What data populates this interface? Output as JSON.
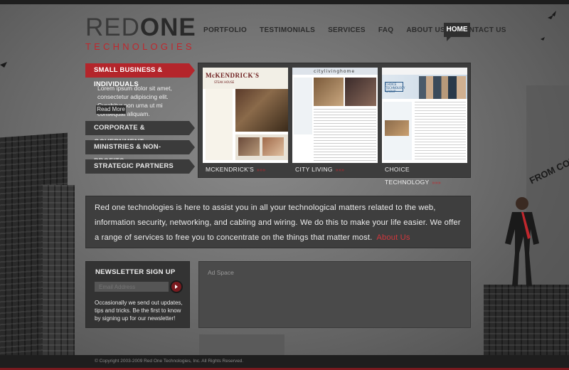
{
  "logo": {
    "red": "RED",
    "one": "ONE",
    "sub": "TECHNOLOGIES"
  },
  "nav": {
    "items": [
      "PORTFOLIO",
      "TESTIMONIALS",
      "SERVICES",
      "FAQ",
      "ABOUT US",
      "CONTACT US"
    ],
    "active": "HOME"
  },
  "categories": [
    {
      "label": "SMALL BUSINESS & INDIVIDUALS",
      "active": true
    },
    {
      "label": "CORPORATE & GOVERNMENT",
      "active": false
    },
    {
      "label": "MINISTRIES & NON-PROFITS",
      "active": false
    },
    {
      "label": "STRATEGIC PARTNERS",
      "active": false
    }
  ],
  "category_desc": "Lorem ipsum dolor sit amet, consectetur adipiscing elit. Curabitur non urna ut mi consequat aliquam.",
  "read_more": "Read More",
  "portfolio": {
    "thumbs": [
      {
        "caption": "MCKENDRICK'S",
        "arrows": "»»»"
      },
      {
        "caption": "CITY LIVING",
        "arrows": "»»»"
      },
      {
        "caption": "CHOICE TECHNOLOGY",
        "arrows": "»»»"
      }
    ],
    "t1_logo": "McKENDRICK'S",
    "t1_sub": "STEAK HOUSE",
    "t2_logo": "citylivinghome",
    "t3_logo": "CHOICE TECHNOLOGY GROUP"
  },
  "intro": {
    "text": "Red one technologies is here to assist you in all your technological matters related to the web, information security, networking, and cabling and wiring. We do this to make your life easier. We offer a range of services to free you to concentrate on the things that matter most.",
    "link": "About Us"
  },
  "newsletter": {
    "title": "NEWSLETTER SIGN UP",
    "placeholder": "Email Address",
    "desc": "Occasionally we send out updates, tips and tricks. Be the first to know by signing up for our newsletter!"
  },
  "ad": {
    "label": "Ad Space"
  },
  "footer": {
    "text": "© Copyright 2003-2009 Red One Technologies, Inc. All Rights Reserved."
  },
  "sign_text": "FROM CON",
  "colors": {
    "accent": "#c0272d",
    "dark": "#333333",
    "panel": "#3d3d3d"
  }
}
